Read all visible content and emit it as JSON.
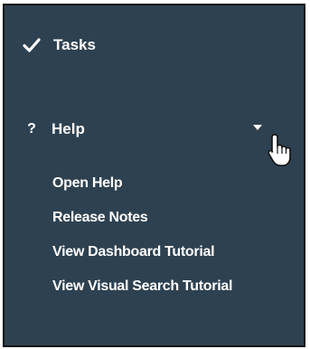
{
  "menu": {
    "tasks_label": "Tasks",
    "help_label": "Help",
    "help_icon_glyph": "?",
    "help_items": [
      "Open Help",
      "Release Notes",
      "View Dashboard Tutorial",
      "View Visual Search Tutorial"
    ]
  },
  "icons": {
    "tasks": "check-icon",
    "help": "question-icon",
    "help_toggle": "caret-down-icon",
    "cursor": "hand-pointer-icon"
  },
  "colors": {
    "panel_background": "#2e4150",
    "text": "#ffffff",
    "border": "#111111"
  }
}
